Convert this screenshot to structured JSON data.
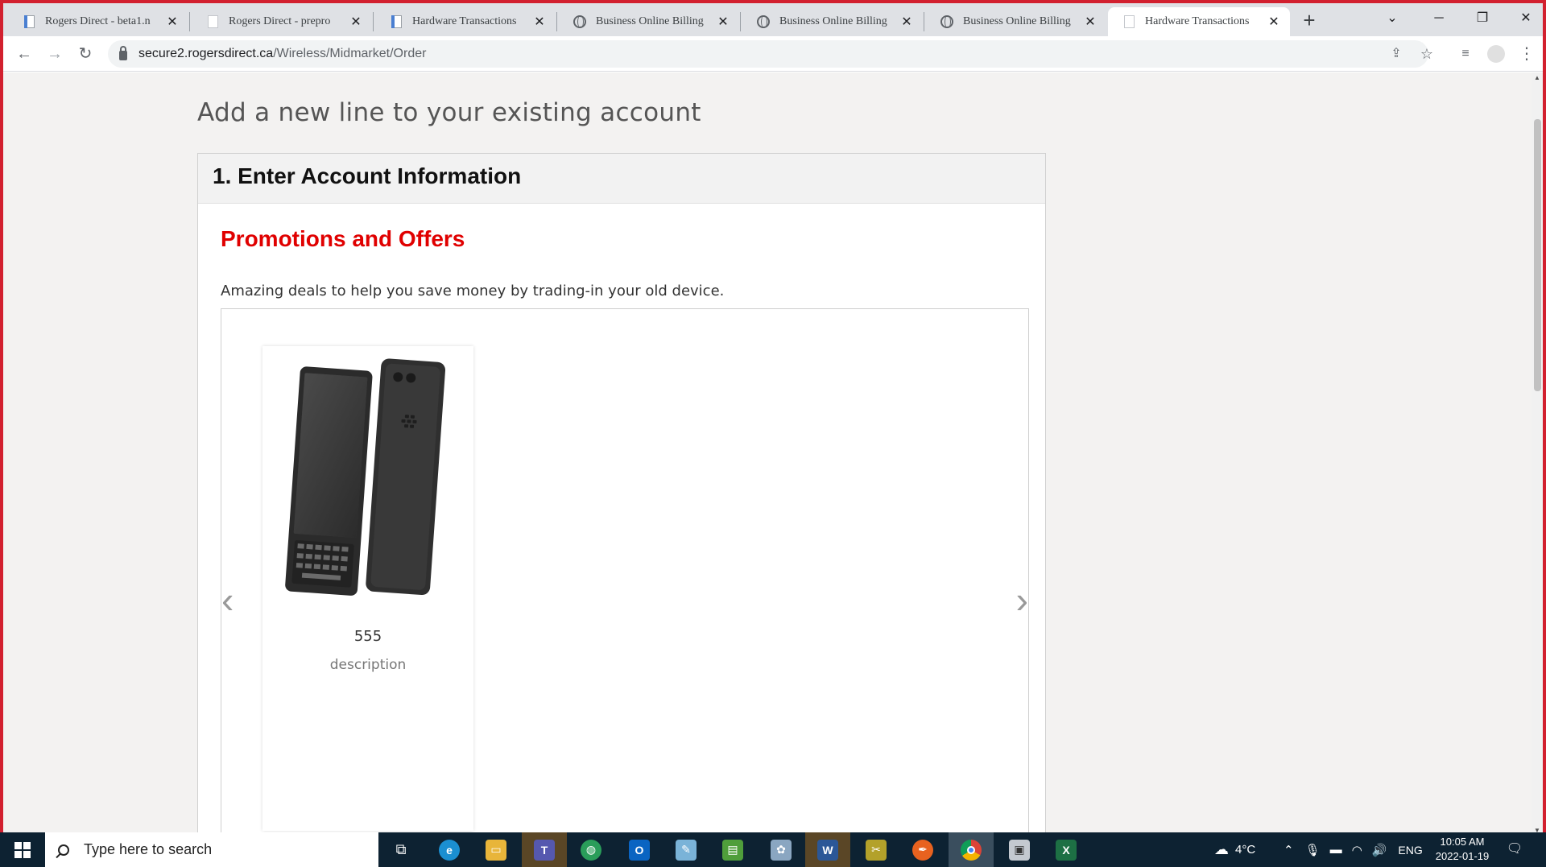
{
  "browser": {
    "tabs": [
      {
        "title": "Rogers Direct - beta1.n",
        "favicon": "document-icon"
      },
      {
        "title": "Rogers Direct - prepro",
        "favicon": "blank-page-icon"
      },
      {
        "title": "Hardware Transactions",
        "favicon": "document-icon"
      },
      {
        "title": "Business Online Billing",
        "favicon": "globe-icon"
      },
      {
        "title": "Business Online Billing",
        "favicon": "globe-icon"
      },
      {
        "title": "Business Online Billing",
        "favicon": "globe-icon"
      },
      {
        "title": "Hardware Transactions",
        "favicon": "blank-page-icon",
        "active": true
      }
    ],
    "url_host": "secure2.rogersdirect.ca",
    "url_path": "/Wireless/Midmarket/Order"
  },
  "page": {
    "heading": "Add a new line to your existing account",
    "step_title": "1. Enter Account Information",
    "promo_title": "Promotions and Offers",
    "promo_description": "Amazing deals to help you save money by trading-in your old device.",
    "carousel": {
      "prev_icon": "chevron-left-icon",
      "next_icon": "chevron-right-icon",
      "cards": [
        {
          "name": "555",
          "description": "description",
          "image": "phone-image"
        }
      ]
    }
  },
  "taskbar": {
    "search_placeholder": "Type here to search",
    "weather": "4°C",
    "language": "ENG",
    "time": "10:05 AM",
    "date": "2022-01-19"
  },
  "colors": {
    "accent_red": "#e00000",
    "frame_red": "#d2202f",
    "taskbar": "#0d2232"
  }
}
